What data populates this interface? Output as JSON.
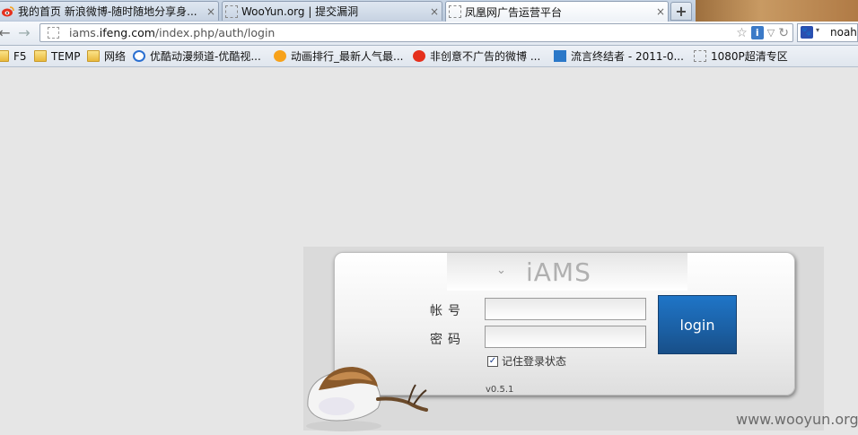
{
  "tabs": [
    {
      "title": "我的首页 新浪微博-随时随地分享身...",
      "close": "×"
    },
    {
      "title": "WooYun.org | 提交漏洞",
      "close": "×"
    },
    {
      "title": "凤凰网广告运营平台",
      "close": "×"
    }
  ],
  "new_tab_label": "+",
  "nav": {
    "back": "←",
    "forward": "→",
    "url_prefix": "iams.",
    "url_domain": "ifeng.com",
    "url_path": "/index.php/auth/login",
    "star": "☆",
    "info": "i",
    "dropdown": "▽",
    "refresh": "↻",
    "search_text": "noah",
    "search_arrow": "▾"
  },
  "bookmarks": [
    {
      "label": "F5",
      "icon": "folder-icon"
    },
    {
      "label": "TEMP",
      "icon": "folder-icon"
    },
    {
      "label": "网络",
      "icon": "folder-icon"
    },
    {
      "label": "优酷动漫频道-优酷视...",
      "icon": "youku-icon"
    },
    {
      "label": "动画排行_最新人气最...",
      "icon": "smiley-icon"
    },
    {
      "label": "非创意不广告的微博 ...",
      "icon": "weibo-icon"
    },
    {
      "label": "流言终结者 - 2011-0...",
      "icon": "bird-icon"
    },
    {
      "label": "1080P超清专区",
      "icon": "blank-page-icon"
    }
  ],
  "login": {
    "logo_text": "iAMS",
    "logo_chevron": "⌄",
    "username_label": "帐号",
    "password_label": "密码",
    "username_value": "",
    "password_value": "",
    "button_label": "login",
    "remember_label": "记住登录状态",
    "remember_checked": true,
    "version": "v0.5.1"
  },
  "watermark": "www.wooyun.org",
  "colors": {
    "login_button": "#1b5fa3",
    "page_background": "#e6e6e6"
  }
}
